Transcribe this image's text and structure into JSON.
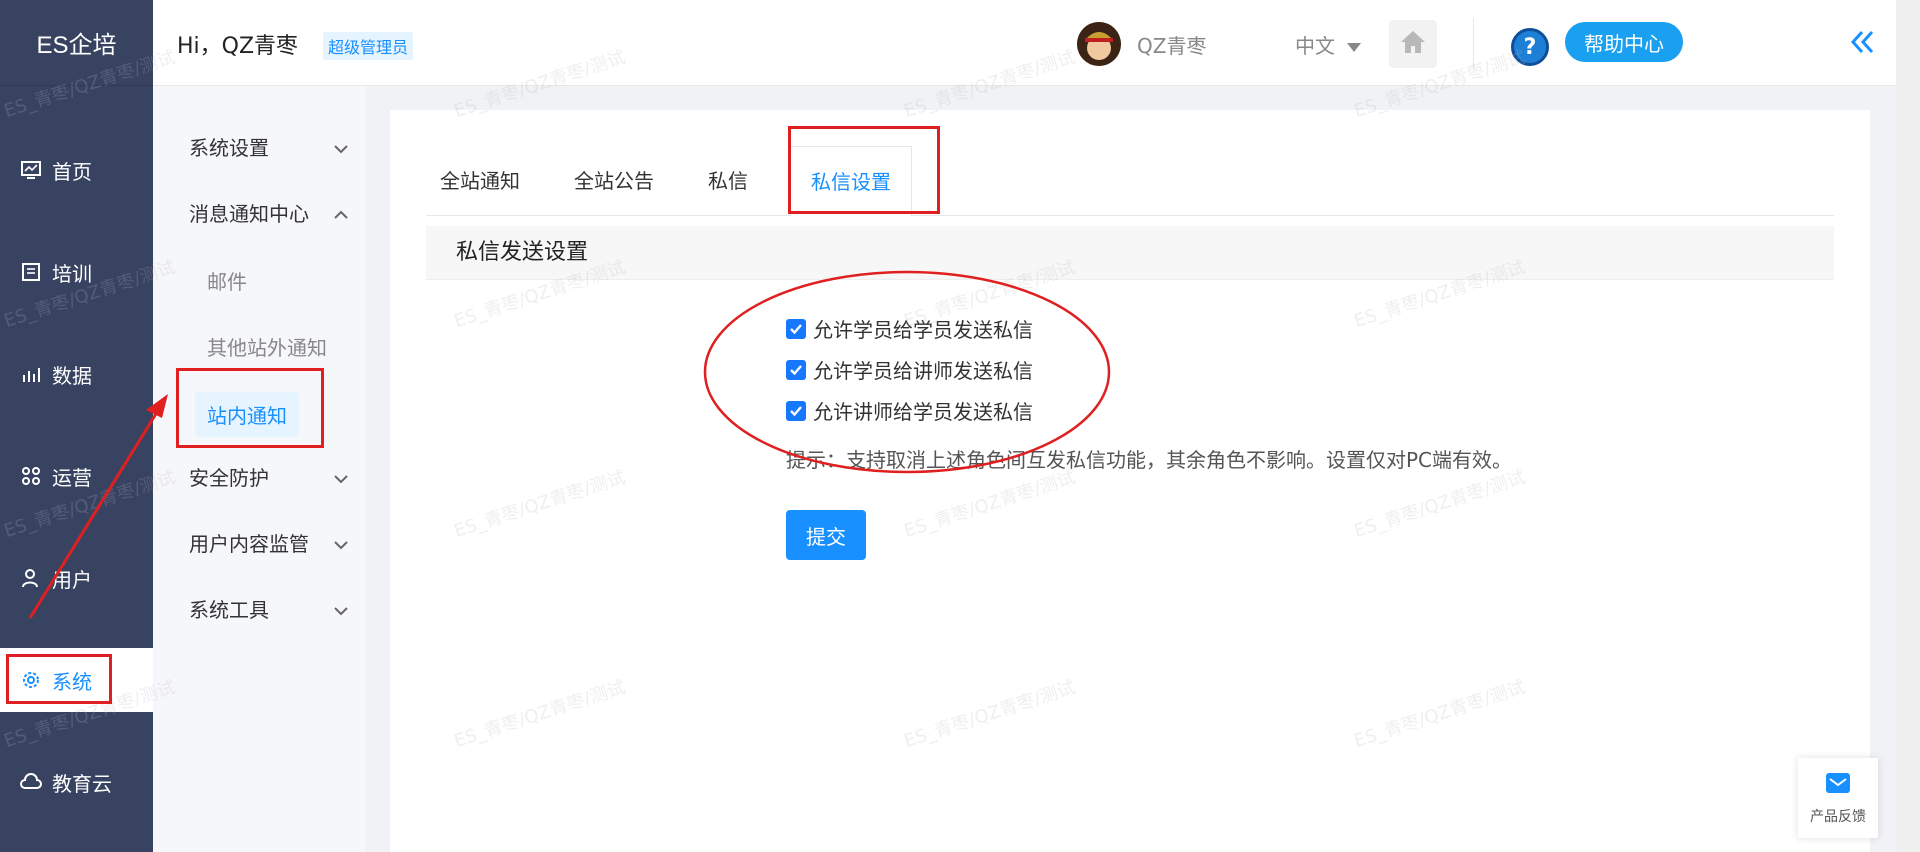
{
  "brand": "ES企培",
  "nav": [
    {
      "label": "首页",
      "icon": "dashboard-icon"
    },
    {
      "label": "培训",
      "icon": "training-icon"
    },
    {
      "label": "数据",
      "icon": "chart-icon"
    },
    {
      "label": "运营",
      "icon": "operation-icon"
    },
    {
      "label": "用户",
      "icon": "user-icon"
    },
    {
      "label": "系统",
      "icon": "gear-icon"
    },
    {
      "label": "教育云",
      "icon": "cloud-icon"
    }
  ],
  "header": {
    "greeting": "Hi，QZ青枣",
    "role": "超级管理员",
    "username": "QZ青枣",
    "language": "中文",
    "help_label": "帮助中心"
  },
  "submenu": {
    "system_settings": "系统设置",
    "message_center": "消息通知中心",
    "email": "邮件",
    "other_offsite": "其他站外通知",
    "onsite": "站内通知",
    "security": "安全防护",
    "content_monitor": "用户内容监管",
    "tools": "系统工具"
  },
  "tabs": [
    "全站通知",
    "全站公告",
    "私信",
    "私信设置"
  ],
  "section_title": "私信发送设置",
  "options": [
    {
      "label": "允许学员给学员发送私信",
      "checked": true
    },
    {
      "label": "允许学员给讲师发送私信",
      "checked": true
    },
    {
      "label": "允许讲师给学员发送私信",
      "checked": true
    }
  ],
  "hint": "提示：支持取消上述角色间互发私信功能，其余角色不影响。设置仅对PC端有效。",
  "submit_label": "提交",
  "feedback_label": "产品反馈",
  "watermark_text": "ES_青枣/QZ青枣/测试",
  "colors": {
    "sidebar": "#384361",
    "accent": "#1890ff",
    "annotation": "#e02020"
  }
}
